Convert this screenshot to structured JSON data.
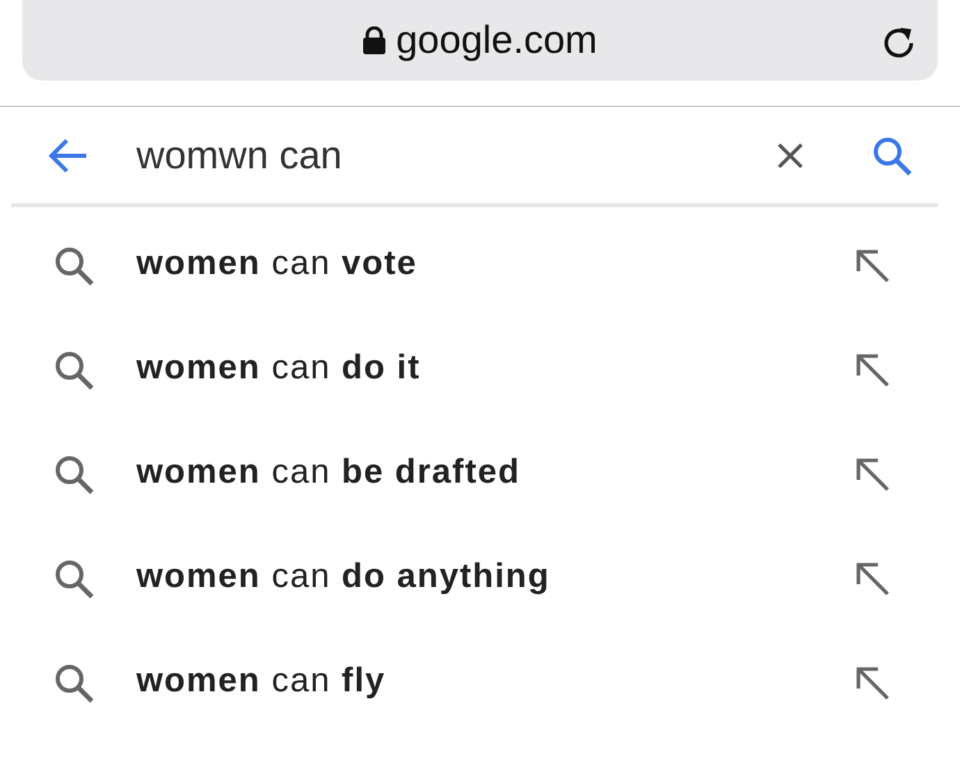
{
  "address_bar": {
    "url": "google.com",
    "secure": true
  },
  "search": {
    "value": "womwn can"
  },
  "suggestions": [
    {
      "text": "**women** can **vote**"
    },
    {
      "text": "**women** can **do it**"
    },
    {
      "text": "**women** can **be drafted**"
    },
    {
      "text": "**women** can **do anything**"
    },
    {
      "text": "**women** can **fly**"
    }
  ]
}
